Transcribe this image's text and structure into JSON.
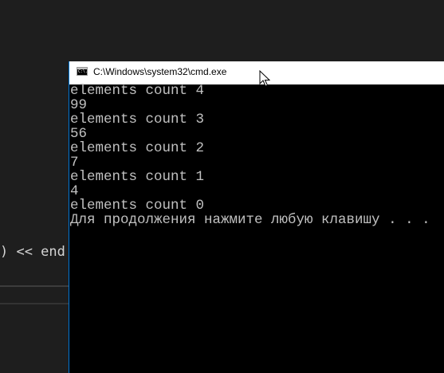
{
  "editor": {
    "code_fragment": ") << end"
  },
  "cmd_window": {
    "title": "C:\\Windows\\system32\\cmd.exe",
    "icon": "console-icon",
    "icon_text": "C:\\.",
    "output_lines": [
      "elements count 4",
      "99",
      "elements count 3",
      "56",
      "elements count 2",
      "7",
      "elements count 1",
      "4",
      "elements count 0",
      "Для продолжения нажмите любую клавишу . . ."
    ]
  },
  "cursor": {
    "icon": "arrow-cursor-icon"
  },
  "colors": {
    "editor_background": "#1e1e1e",
    "console_background": "#000000",
    "console_text": "#c0c0c0",
    "titlebar_background": "#ffffff",
    "window_border": "#0078d7"
  }
}
